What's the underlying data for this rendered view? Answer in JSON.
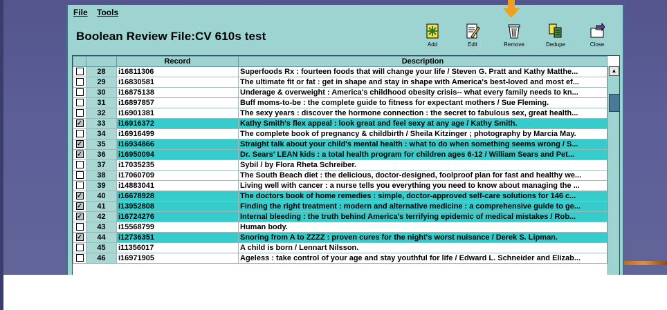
{
  "menu": [
    "File",
    "Tools"
  ],
  "title": "Boolean Review File:CV 610s test",
  "toolbar": {
    "add": "Add",
    "edit": "Edit",
    "remove": "Remove",
    "dedupe": "Dedupe",
    "close": "Close"
  },
  "columns": {
    "record": "Record",
    "description": "Description"
  },
  "rows": [
    {
      "n": "28",
      "checked": false,
      "record": "i16811306",
      "desc": "Superfoods Rx : fourteen foods that will change your life / Steven G. Pratt and Kathy Matthe..."
    },
    {
      "n": "29",
      "checked": false,
      "record": "i16830581",
      "desc": "The ultimate fit or fat : get in shape and stay in shape with America's best-loved and most ef..."
    },
    {
      "n": "30",
      "checked": false,
      "record": "i16875138",
      "desc": "Underage & overweight : America's childhood obesity crisis-- what every family needs to kn..."
    },
    {
      "n": "31",
      "checked": false,
      "record": "i16897857",
      "desc": "Buff moms-to-be : the complete guide to fitness for expectant mothers / Sue Fleming."
    },
    {
      "n": "32",
      "checked": false,
      "record": "i16901381",
      "desc": "The sexy years : discover the hormone connection : the secret to fabulous sex, great health..."
    },
    {
      "n": "33",
      "checked": true,
      "record": "i16916372",
      "desc": "Kathy Smith's flex appeal : look great and feel sexy at any age / Kathy Smith."
    },
    {
      "n": "34",
      "checked": false,
      "record": "i16916499",
      "desc": "The complete book of pregnancy & childbirth / Sheila Kitzinger ; photography by Marcia May."
    },
    {
      "n": "35",
      "checked": true,
      "record": "i16934866",
      "desc": "Straight talk about your child's mental health : what to do when something seems wrong / S..."
    },
    {
      "n": "36",
      "checked": true,
      "record": "i16950094",
      "desc": "Dr. Sears' LEAN kids : a total health program for children ages 6-12 / William Sears and Pet..."
    },
    {
      "n": "37",
      "checked": false,
      "record": "i17035235",
      "desc": "Sybil / by Flora Rheta Schreiber."
    },
    {
      "n": "38",
      "checked": false,
      "record": "i17060709",
      "desc": "The South Beach diet : the delicious, doctor-designed, foolproof plan for fast and healthy we..."
    },
    {
      "n": "39",
      "checked": false,
      "record": "i14883041",
      "desc": "Living well with cancer : a nurse tells you everything you need to know about managing the ..."
    },
    {
      "n": "40",
      "checked": true,
      "record": "i16678928",
      "desc": "The doctors book of home remedies : simple, doctor-approved self-care solutions for 146 c..."
    },
    {
      "n": "41",
      "checked": true,
      "record": "i13952808",
      "desc": "Finding the right treatment : modern and alternative medicine : a comprehensive guide to ge..."
    },
    {
      "n": "42",
      "checked": true,
      "record": "i16724276",
      "desc": "Internal bleeding : the truth behind America's terrifying epidemic of medical mistakes / Rob..."
    },
    {
      "n": "43",
      "checked": false,
      "record": "i15568799",
      "desc": "Human body."
    },
    {
      "n": "44",
      "checked": true,
      "record": "i12736351",
      "desc": "Snoring from A to ZZZZ : proven cures for the night's worst nuisance / Derek S. Lipman."
    },
    {
      "n": "45",
      "checked": false,
      "record": "i11356017",
      "desc": "A child is born / Lennart Nilsson."
    },
    {
      "n": "46",
      "checked": false,
      "record": "i16971905",
      "desc": "Ageless : take control of your age and stay youthful for life / Edward L. Schneider and Elizab..."
    }
  ],
  "colors": {
    "selected": "#36cccc",
    "panel": "#9dd4d2",
    "arrow": "#f0a020"
  }
}
